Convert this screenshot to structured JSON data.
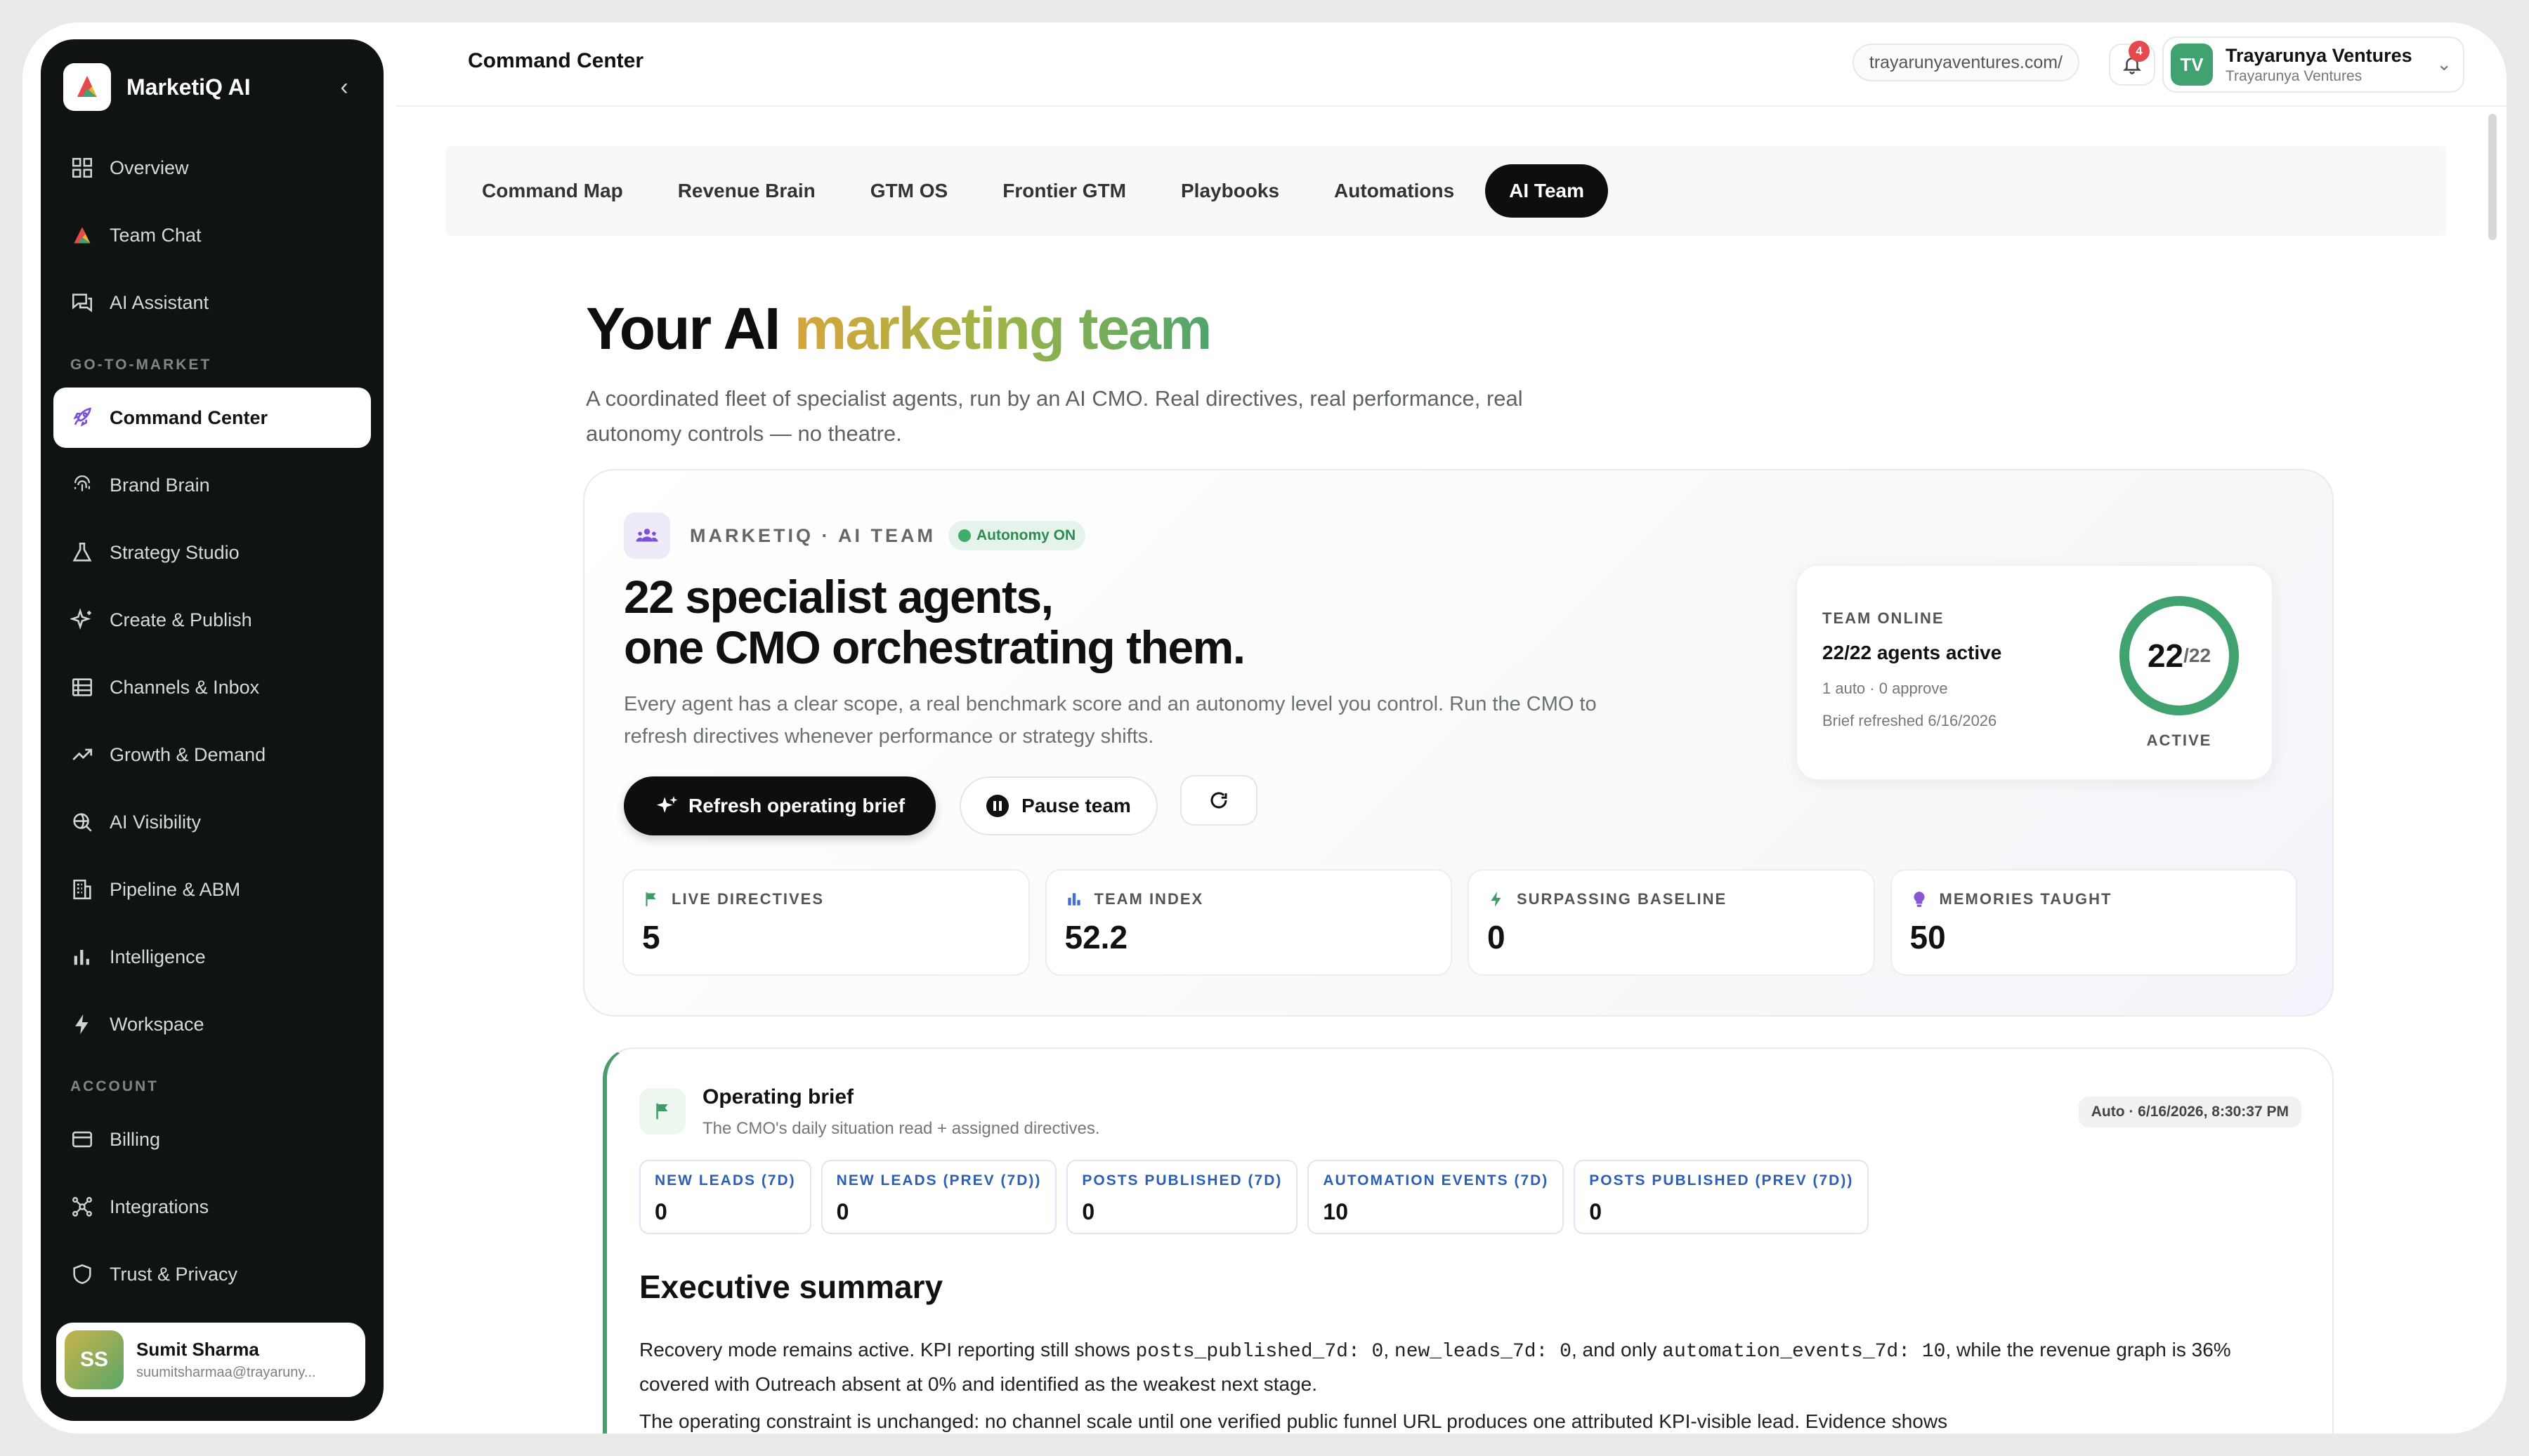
{
  "app": {
    "name": "MarketiQ AI"
  },
  "sidebar": {
    "items_top": [
      {
        "label": "Overview"
      },
      {
        "label": "Team Chat"
      },
      {
        "label": "AI Assistant"
      }
    ],
    "section_gtm": "GO-TO-MARKET",
    "items_gtm": [
      {
        "label": "Command Center"
      },
      {
        "label": "Brand Brain"
      },
      {
        "label": "Strategy Studio"
      },
      {
        "label": "Create & Publish"
      },
      {
        "label": "Channels & Inbox"
      },
      {
        "label": "Growth & Demand"
      },
      {
        "label": "AI Visibility"
      },
      {
        "label": "Pipeline & ABM"
      },
      {
        "label": "Intelligence"
      },
      {
        "label": "Workspace"
      }
    ],
    "section_account": "ACCOUNT",
    "items_account": [
      {
        "label": "Billing"
      },
      {
        "label": "Integrations"
      },
      {
        "label": "Trust & Privacy"
      }
    ],
    "user": {
      "initials": "SS",
      "name": "Sumit Sharma",
      "email": "suumitsharmaa@trayaruny..."
    }
  },
  "header": {
    "title": "Command Center",
    "url": "trayarunyaventures.com/",
    "notifications": "4",
    "org": {
      "initials": "TV",
      "name": "Trayarunya Ventures",
      "sub": "Trayarunya Ventures"
    }
  },
  "tabs": [
    "Command Map",
    "Revenue Brain",
    "GTM OS",
    "Frontier GTM",
    "Playbooks",
    "Automations",
    "AI Team"
  ],
  "hero": {
    "title_plain": "Your AI ",
    "title_grad": "marketing team",
    "subtitle": "A coordinated fleet of specialist agents, run by an AI CMO. Real directives, real performance, real autonomy controls — no theatre."
  },
  "team_card": {
    "label": "MARKETIQ · AI TEAM",
    "autonomy": "Autonomy ON",
    "title_line1": "22 specialist agents,",
    "title_line2": "one CMO orchestrating them.",
    "description": "Every agent has a clear scope, a real benchmark score and an autonomy level you control. Run the CMO to refresh directives whenever performance or strategy shifts.",
    "refresh_label": "Refresh operating brief",
    "pause_label": "Pause team",
    "online": {
      "label": "TEAM ONLINE",
      "main": "22/22 agents active",
      "sub": "1 auto · 0 approve",
      "refreshed": "Brief refreshed 6/16/2026",
      "num": "22",
      "den": "/22",
      "caption": "ACTIVE",
      "active_fraction": 1.0
    },
    "stats": [
      {
        "label": "LIVE DIRECTIVES",
        "value": "5",
        "icon": "flag-icon",
        "color": "#3f9a66"
      },
      {
        "label": "TEAM INDEX",
        "value": "52.2",
        "icon": "bar-chart-icon",
        "color": "#3f6fd0"
      },
      {
        "label": "SURPASSING BASELINE",
        "value": "0",
        "icon": "bolt-icon",
        "color": "#3f9a66"
      },
      {
        "label": "MEMORIES TAUGHT",
        "value": "50",
        "icon": "bulb-icon",
        "color": "#8a55d6"
      }
    ]
  },
  "brief": {
    "title": "Operating brief",
    "subtitle": "The CMO's daily situation read + assigned directives.",
    "stamp": "Auto · 6/16/2026, 8:30:37 PM",
    "kpis": [
      {
        "label": "NEW LEADS (7D)",
        "value": "0"
      },
      {
        "label": "NEW LEADS (PREV (7D))",
        "value": "0"
      },
      {
        "label": "POSTS PUBLISHED (7D)",
        "value": "0"
      },
      {
        "label": "AUTOMATION EVENTS (7D)",
        "value": "10"
      },
      {
        "label": "POSTS PUBLISHED (PREV (7D))",
        "value": "0"
      }
    ],
    "exec_title": "Executive summary",
    "p1_a": "Recovery mode remains active. KPI reporting still shows ",
    "p1_m1": "posts_published_7d: 0",
    "p1_b": ", ",
    "p1_m2": "new_leads_7d: 0",
    "p1_c": ", and only ",
    "p1_m3": "automation_events_7d: 10",
    "p1_d": ", while the revenue graph is 36% covered with Outreach absent at 0% and identified as the weakest next stage.",
    "p2": "The operating constraint is unchanged: no channel scale until one verified public funnel URL produces one attributed KPI-visible lead. Evidence shows"
  }
}
